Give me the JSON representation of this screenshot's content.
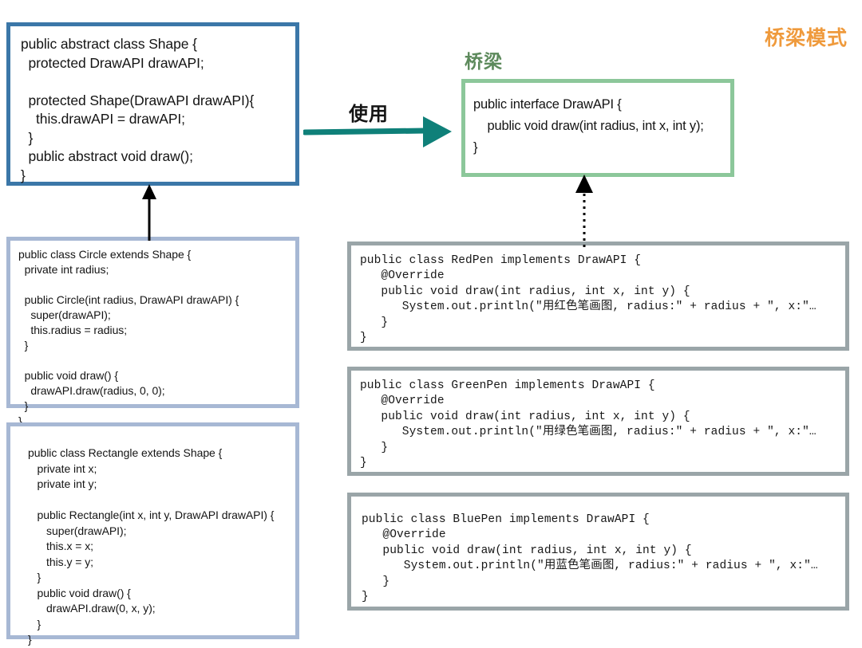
{
  "title": "桥梁模式",
  "labels": {
    "bridge": "桥梁",
    "uses": "使用"
  },
  "colors": {
    "title": "#ef9a3c",
    "bridge_label": "#5d8a5c",
    "shape_border": "#3b77a8",
    "subclass_border": "#a7b8d4",
    "interface_border": "#8cc79a",
    "impl_border": "#9aa5a8",
    "uses_arrow": "#0f8079",
    "extends_arrow": "#000000"
  },
  "boxes": {
    "shape": {
      "name": "Shape",
      "code": "public abstract class Shape {\n  protected DrawAPI drawAPI;\n\n  protected Shape(DrawAPI drawAPI){\n    this.drawAPI = drawAPI;\n  }\n  public abstract void draw();\n}"
    },
    "circle": {
      "name": "Circle",
      "code": "public class Circle extends Shape {\n  private int radius;\n\n  public Circle(int radius, DrawAPI drawAPI) {\n    super(drawAPI);\n    this.radius = radius;\n  }\n\n  public void draw() {\n    drawAPI.draw(radius, 0, 0);\n  }\n}"
    },
    "rectangle": {
      "name": "Rectangle",
      "code": "public class Rectangle extends Shape {\n   private int x;\n   private int y;\n\n   public Rectangle(int x, int y, DrawAPI drawAPI) {\n      super(drawAPI);\n      this.x = x;\n      this.y = y;\n   }\n   public void draw() {\n      drawAPI.draw(0, x, y);\n   }\n}"
    },
    "drawapi": {
      "name": "DrawAPI",
      "code": "public interface DrawAPI {\n    public void draw(int radius, int x, int y);\n}"
    },
    "redpen": {
      "name": "RedPen",
      "code": "public class RedPen implements DrawAPI {\n   @Override\n   public void draw(int radius, int x, int y) {\n      System.out.println(\"用红色笔画图, radius:\" + radius + \", x:\"…\n   }\n}"
    },
    "greenpen": {
      "name": "GreenPen",
      "code": "public class GreenPen implements DrawAPI {\n   @Override\n   public void draw(int radius, int x, int y) {\n      System.out.println(\"用绿色笔画图, radius:\" + radius + \", x:\"…\n   }\n}"
    },
    "bluepen": {
      "name": "BluePen",
      "code": "public class BluePen implements DrawAPI {\n   @Override\n   public void draw(int radius, int x, int y) {\n      System.out.println(\"用蓝色笔画图, radius:\" + radius + \", x:\"…\n   }\n}"
    }
  }
}
